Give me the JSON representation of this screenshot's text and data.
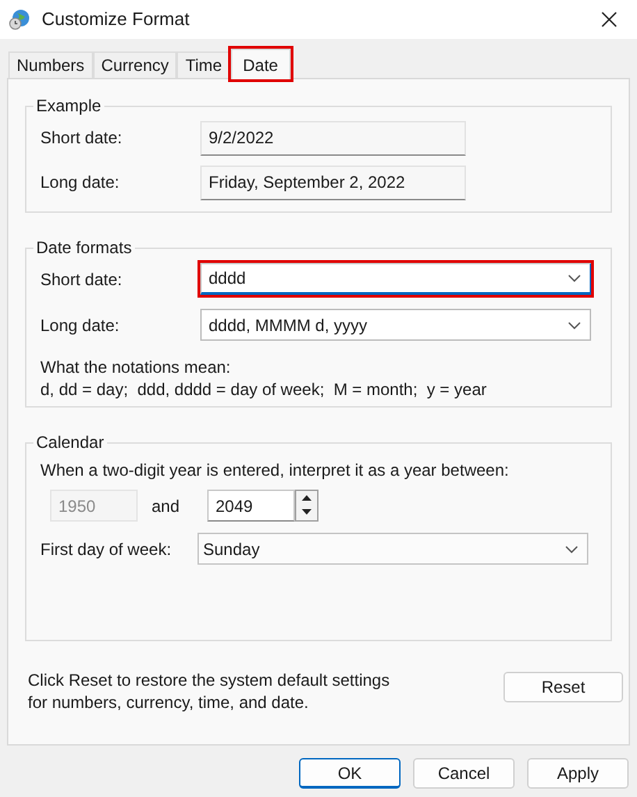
{
  "window": {
    "title": "Customize Format"
  },
  "tabs": [
    {
      "label": "Numbers",
      "selected": false,
      "highlighted": false
    },
    {
      "label": "Currency",
      "selected": false,
      "highlighted": false
    },
    {
      "label": "Time",
      "selected": false,
      "highlighted": false
    },
    {
      "label": "Date",
      "selected": true,
      "highlighted": true
    }
  ],
  "example": {
    "title": "Example",
    "rows": [
      {
        "label": "Short date:",
        "value": "9/2/2022"
      },
      {
        "label": "Long date:",
        "value": "Friday, September 2, 2022"
      }
    ]
  },
  "date_formats": {
    "title": "Date formats",
    "rows": [
      {
        "label": "Short date:",
        "value": "dddd",
        "focused": true,
        "highlighted": true
      },
      {
        "label": "Long date:",
        "value": "dddd, MMMM d, yyyy",
        "focused": false,
        "highlighted": false
      }
    ],
    "notes": [
      "What the notations mean:",
      "d, dd = day;  ddd, dddd = day of week;  M = month;  y = year"
    ]
  },
  "calendar": {
    "title": "Calendar",
    "prompt": "When a two-digit year is entered, interpret it as a year between:",
    "year_from": {
      "value": "1950",
      "disabled": true
    },
    "and": "and",
    "year_to": {
      "value": "2049",
      "disabled": false
    },
    "first_day": {
      "label": "First day of week:",
      "value": "Sunday"
    }
  },
  "reset": {
    "text": "Click Reset to restore the system default settings for numbers, currency, time, and date.",
    "button": "Reset"
  },
  "buttons": [
    {
      "label": "OK",
      "default": true
    },
    {
      "label": "Cancel",
      "default": false
    },
    {
      "label": "Apply",
      "default": false
    }
  ]
}
